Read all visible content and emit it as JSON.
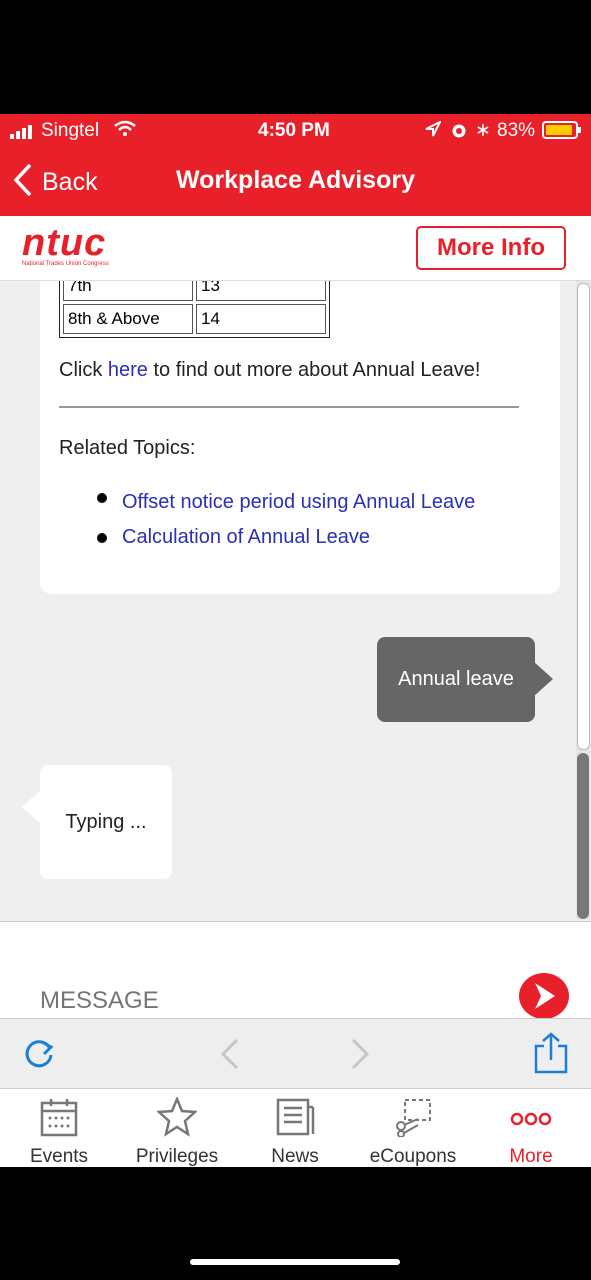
{
  "status": {
    "carrier": "Singtel",
    "time": "4:50 PM",
    "battery": "83%"
  },
  "nav": {
    "back_label": "Back",
    "title": "Workplace Advisory"
  },
  "brand": {
    "logo_text": "ntuc",
    "logo_sub": "National Trades Union Congress",
    "more_info_label": "More Info"
  },
  "chat": {
    "table_rows": [
      [
        "7th",
        "13"
      ],
      [
        "8th & Above",
        "14"
      ]
    ],
    "click_prefix": "Click ",
    "click_link": "here",
    "click_suffix": " to find out more about Annual Leave!",
    "related_heading": "Related Topics:",
    "related_links": [
      "Offset notice period using Annual Leave",
      "Calculation of Annual Leave"
    ],
    "user_message": "Annual leave",
    "bot_typing": "Typing ..."
  },
  "input": {
    "placeholder": "MESSAGE"
  },
  "tabs": [
    {
      "label": "Events",
      "icon": "calendar-icon"
    },
    {
      "label": "Privileges",
      "icon": "star-icon"
    },
    {
      "label": "News",
      "icon": "newspaper-icon"
    },
    {
      "label": "eCoupons",
      "icon": "scissors-icon"
    },
    {
      "label": "More",
      "icon": "more-dots-icon"
    }
  ],
  "colors": {
    "brand_red": "#e8202a",
    "link_blue": "#2b2fb6",
    "bubble_grey": "#666666"
  }
}
